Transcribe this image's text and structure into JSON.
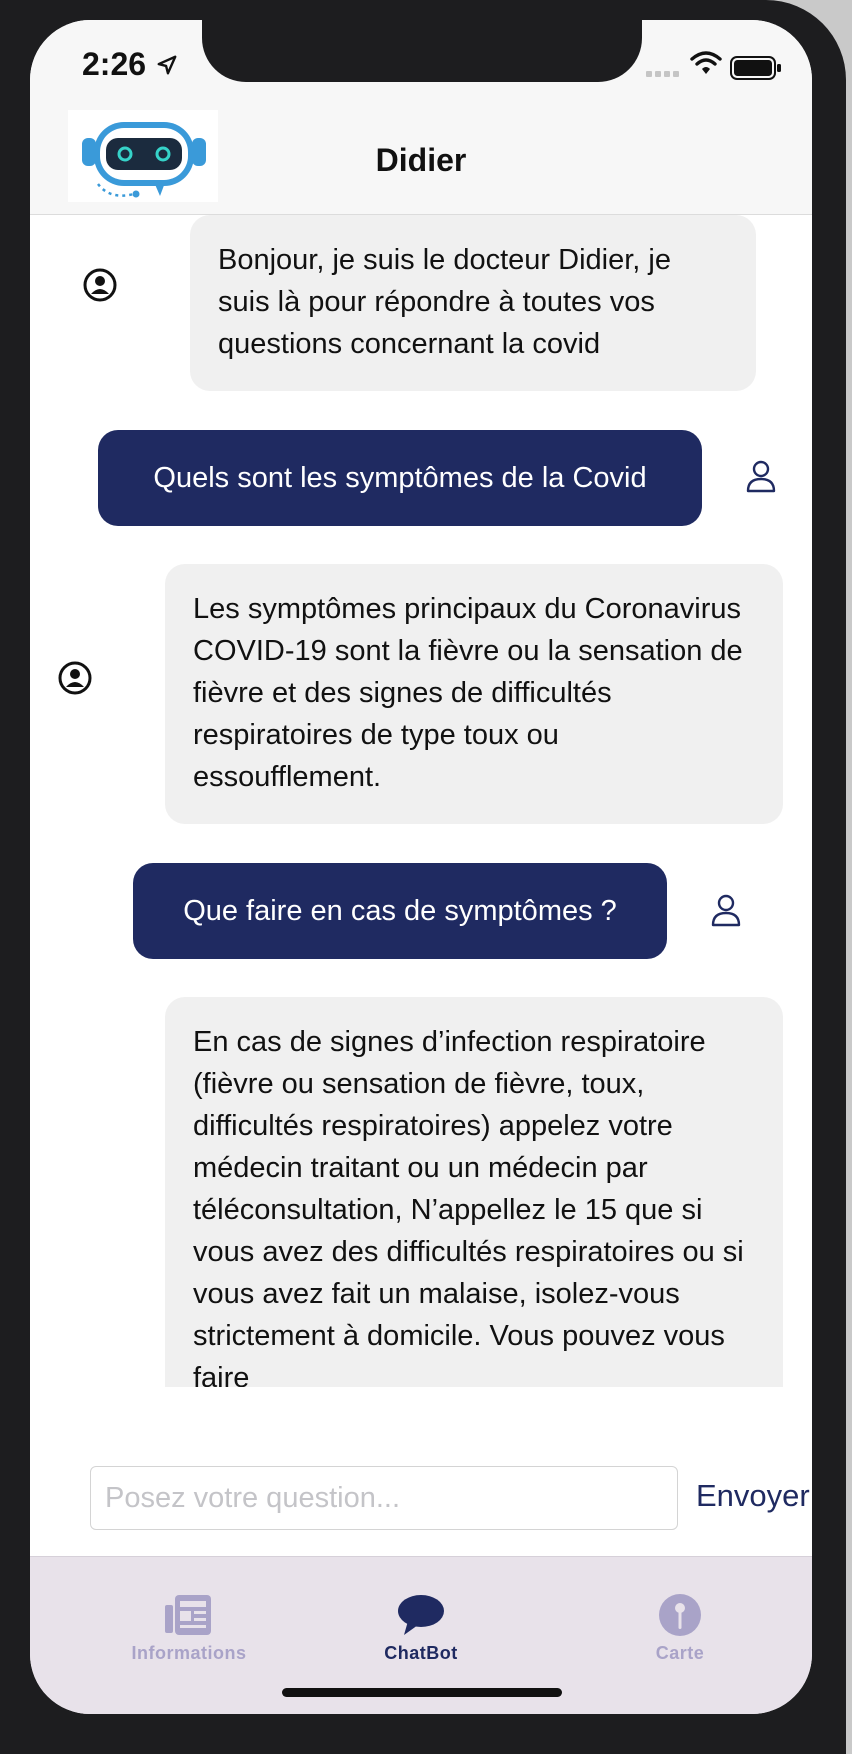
{
  "status_bar": {
    "time": "2:26"
  },
  "header": {
    "title": "Didier"
  },
  "messages": [
    {
      "from": "bot",
      "text": "Bonjour, je suis le docteur Didier, je suis là pour répondre à toutes vos questions concernant la covid"
    },
    {
      "from": "user",
      "text": "Quels sont les symptômes de la Covid"
    },
    {
      "from": "bot",
      "text": "Les symptômes principaux du Coronavirus COVID-19 sont la fièvre ou la sensation de fièvre et des signes de difficultés respiratoires de type toux ou essoufflement."
    },
    {
      "from": "user",
      "text": "Que faire en cas de symptômes ?"
    },
    {
      "from": "bot",
      "text": "En cas de signes d’infection respiratoire (fièvre ou sensation de fièvre, toux, difficultés respiratoires) appelez votre médecin traitant ou un médecin par téléconsultation, N’appellez le 15 que si vous avez des difficultés respiratoires ou si vous avez fait un malaise, isolez-vous strictement à domicile. Vous pouvez vous faire"
    }
  ],
  "composer": {
    "placeholder": "Posez votre question...",
    "send_label": "Envoyer"
  },
  "tabs": [
    {
      "label": "Informations",
      "icon": "newspaper-icon",
      "active": false
    },
    {
      "label": "ChatBot",
      "icon": "chat-bubble-icon",
      "active": true
    },
    {
      "label": "Carte",
      "icon": "map-pin-icon",
      "active": false
    }
  ],
  "colors": {
    "accent": "#1f2a61",
    "bot_bubble": "#f0f0f0",
    "tab_bar": "#e8e2ea",
    "tab_inactive": "#a9a3c8",
    "logo_blue": "#3a9ad9"
  }
}
